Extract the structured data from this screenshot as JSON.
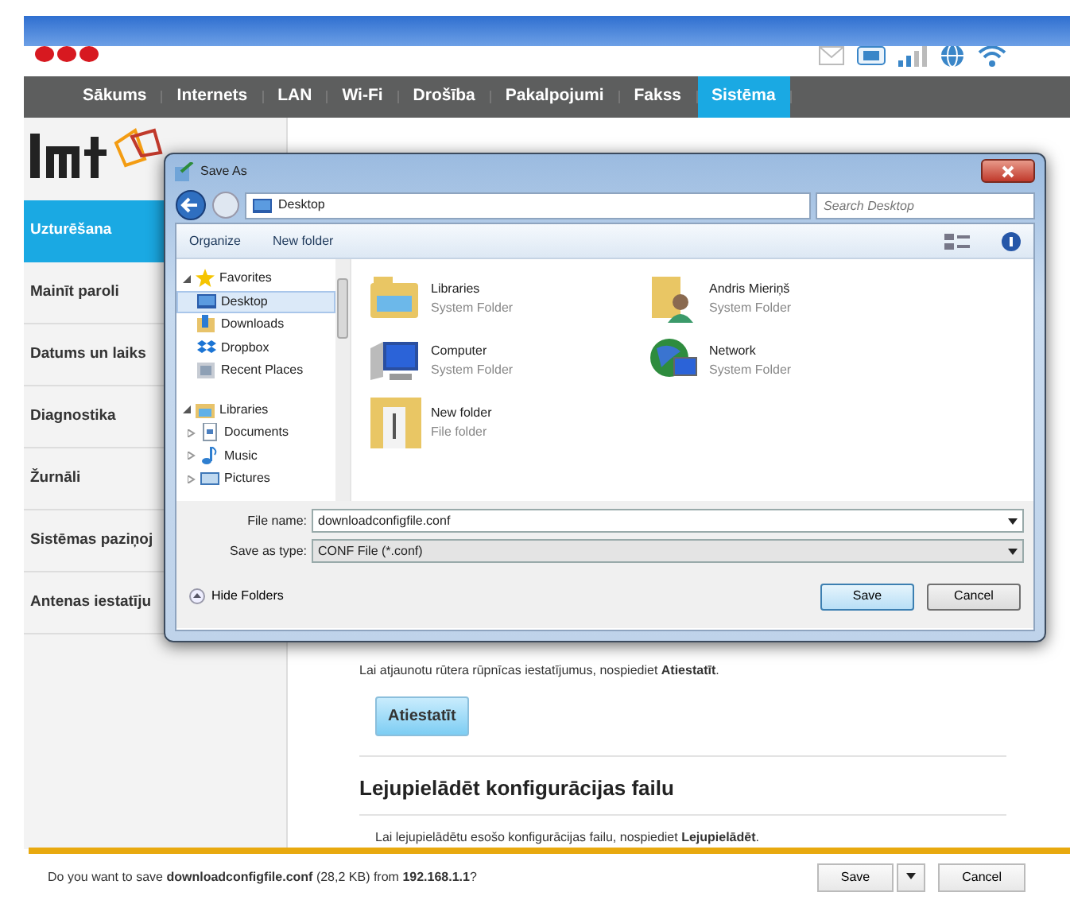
{
  "nav": [
    {
      "label": "Sākums",
      "selected": false
    },
    {
      "label": "Internets",
      "selected": false
    },
    {
      "label": "LAN",
      "selected": false
    },
    {
      "label": "Wi-Fi",
      "selected": false
    },
    {
      "label": "Drošība",
      "selected": false
    },
    {
      "label": "Pakalpojumi",
      "selected": false
    },
    {
      "label": "Fakss",
      "selected": false
    },
    {
      "label": "Sistēma",
      "selected": true
    }
  ],
  "sidebar": [
    {
      "label": "Uzturēšana",
      "selected": true
    },
    {
      "label": "Mainīt paroli",
      "selected": false
    },
    {
      "label": "Datums un laiks",
      "selected": false
    },
    {
      "label": "Diagnostika",
      "selected": false
    },
    {
      "label": "Žurnāli",
      "selected": false
    },
    {
      "label": "Sistēmas paziņoj",
      "selected": false
    },
    {
      "label": "Antenas iestatīju",
      "selected": false
    }
  ],
  "content": {
    "reset_text": "Lai atjaunotu rūtera rūpnīcas iestatījumus, nospiediet **Atiestatīt**.",
    "reset_button": "Atiestatīt",
    "download_heading": "Lejupielādēt konfigurācijas failu",
    "download_text": "Lai lejupielādētu esošo konfigurācijas failu, nospiediet **Lejupielādēt**."
  },
  "dialog": {
    "title": "Save As",
    "path": "Desktop",
    "search_placeholder": "Search Desktop",
    "toolbar": [
      "Organize",
      "New folder"
    ],
    "tree": [
      {
        "label": "Favorites",
        "kind": "star",
        "expanded": true,
        "children": [
          {
            "label": "Desktop",
            "kind": "desktop",
            "selected": true
          },
          {
            "label": "Downloads",
            "kind": "downloads",
            "selected": false
          },
          {
            "label": "Dropbox",
            "kind": "dropbox",
            "selected": false
          },
          {
            "label": "Recent Places",
            "kind": "recent",
            "selected": false
          }
        ]
      },
      {
        "label": "Libraries",
        "kind": "libraries",
        "expanded": true,
        "children": [
          {
            "label": "Documents",
            "kind": "documents",
            "selected": false,
            "expanded": false
          },
          {
            "label": "Music",
            "kind": "music",
            "selected": false,
            "expanded": false
          },
          {
            "label": "Pictures",
            "kind": "pictures",
            "selected": false,
            "expanded": false
          }
        ]
      }
    ],
    "items": [
      {
        "name": "Libraries",
        "type": "System Folder",
        "kind": "libraries"
      },
      {
        "name": "Andris Mieriņš",
        "type": "System Folder",
        "kind": "user"
      },
      {
        "name": "Computer",
        "type": "System Folder",
        "kind": "computer"
      },
      {
        "name": "Network",
        "type": "System Folder",
        "kind": "network"
      },
      {
        "name": "New folder",
        "type": "File folder",
        "kind": "folder"
      }
    ],
    "file_name_label": "File name:",
    "file_name": "downloadconfigfile.conf",
    "type_label": "Save as type:",
    "file_type": "CONF File (*.conf)",
    "hide_folders": "Hide Folders",
    "buttons": [
      {
        "label": "Save",
        "kind": "default"
      },
      {
        "label": "Cancel",
        "kind": "normal"
      }
    ]
  },
  "download_bar": {
    "message": "Do you want to save **downloadconfigfile.conf** (28,2 KB) from **192.168.1.1**?",
    "buttons": [
      "Save",
      "Cancel"
    ]
  }
}
